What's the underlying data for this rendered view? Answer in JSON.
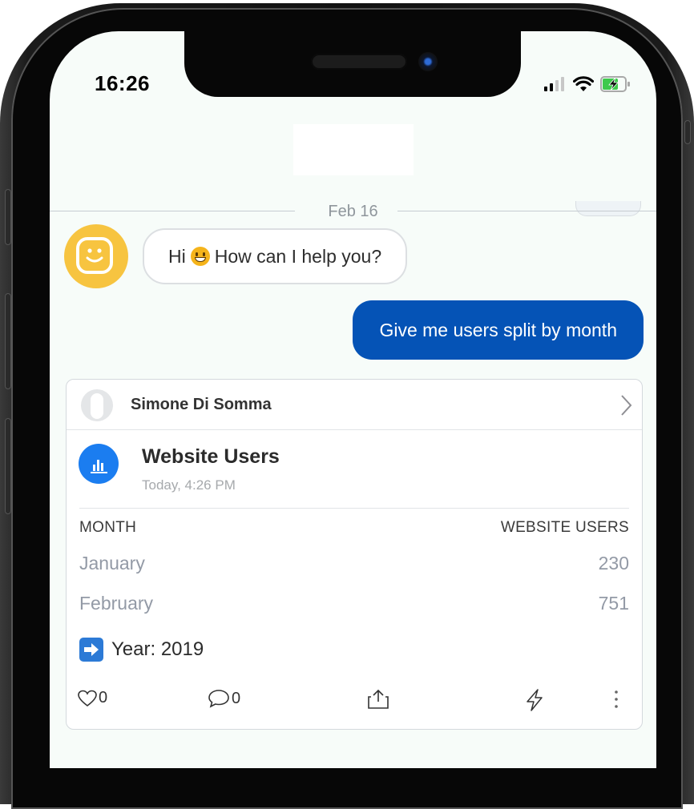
{
  "status_bar": {
    "time": "16:26"
  },
  "chat": {
    "date_divider": "Feb 16",
    "bot_message": {
      "before": "Hi",
      "emoji": "grinning-face-emoji",
      "after": "How can I help you?"
    },
    "user_message": "Give me users split by month"
  },
  "card": {
    "author": "Simone Di Somma",
    "widget": {
      "title": "Website Users",
      "timestamp": "Today, 4:26 PM",
      "columns": [
        "MONTH",
        "WEBSITE USERS"
      ],
      "rows": [
        {
          "month": "January",
          "users": "230"
        },
        {
          "month": "February",
          "users": "751"
        }
      ],
      "year_label": "Year: 2019"
    },
    "actions": {
      "likes": "0",
      "comments": "0"
    }
  },
  "colors": {
    "accent_blue": "#0553b6",
    "widget_icon_blue": "#1b7df0",
    "avatar_yellow": "#f7c440",
    "screen_bg": "#f7fcf9"
  },
  "icons": [
    "signal-icon",
    "wifi-icon",
    "battery-charging-icon",
    "bot-avatar-icon",
    "chevron-right-icon",
    "bar-chart-icon",
    "right-arrow-icon",
    "heart-icon",
    "comment-icon",
    "share-icon",
    "lightning-icon",
    "more-icon"
  ]
}
